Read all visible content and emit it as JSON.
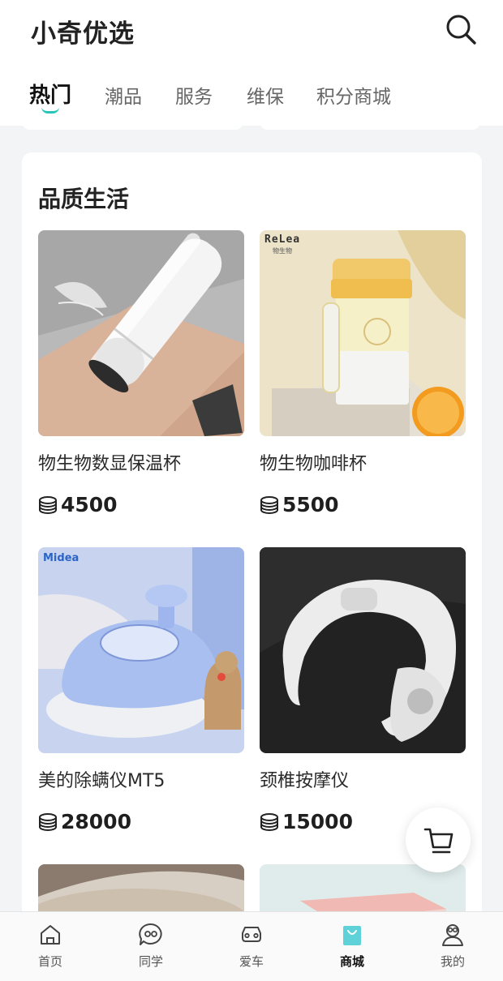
{
  "header": {
    "title": "小奇优选"
  },
  "tabs": [
    {
      "label": "热门",
      "active": true
    },
    {
      "label": "潮品",
      "active": false
    },
    {
      "label": "服务",
      "active": false
    },
    {
      "label": "维保",
      "active": false
    },
    {
      "label": "积分商城",
      "active": false
    }
  ],
  "section": {
    "title": "品质生活"
  },
  "products": [
    {
      "name": "物生物数显保温杯",
      "price": "4500",
      "image": "insulated-bottle"
    },
    {
      "name": "物生物咖啡杯",
      "price": "5500",
      "image": "coffee-cup",
      "brand": "ReLea",
      "brand_sub": "物生物"
    },
    {
      "name": "美的除螨仪MT5",
      "price": "28000",
      "image": "mite-remover",
      "brand": "Midea"
    },
    {
      "name": "颈椎按摩仪",
      "price": "15000",
      "image": "neck-massager"
    }
  ],
  "colors": {
    "accent": "#27c4b9",
    "shop_accent": "#5fd1d8"
  },
  "bottom_nav": [
    {
      "label": "首页",
      "icon": "home-icon",
      "active": false
    },
    {
      "label": "同学",
      "icon": "chat-icon",
      "active": false
    },
    {
      "label": "爱车",
      "icon": "car-icon",
      "active": false
    },
    {
      "label": "商城",
      "icon": "shopping-bag-icon",
      "active": true
    },
    {
      "label": "我的",
      "icon": "profile-icon",
      "active": false
    }
  ]
}
